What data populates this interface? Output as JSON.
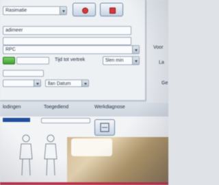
{
  "form": {
    "type_select": "Rasimatie",
    "name_field": "adimeer",
    "dropdown_value": "RPC",
    "departure_label": "Tijd tot vertrek",
    "departure_select": "5len min",
    "small_select_1": "",
    "small_select_2": "llan Datum"
  },
  "right_panel": {
    "label_1": "Voor",
    "label_2": "La",
    "label_3": "Ge"
  },
  "tabs": {
    "tab_1": "lodingen",
    "tab_2": "Toegediend",
    "tab_3": "Werkdiagnose"
  },
  "colors": {
    "accent_red": "#d8383a",
    "accent_green": "#3f9e33",
    "selection_blue": "#1f4f9c"
  }
}
